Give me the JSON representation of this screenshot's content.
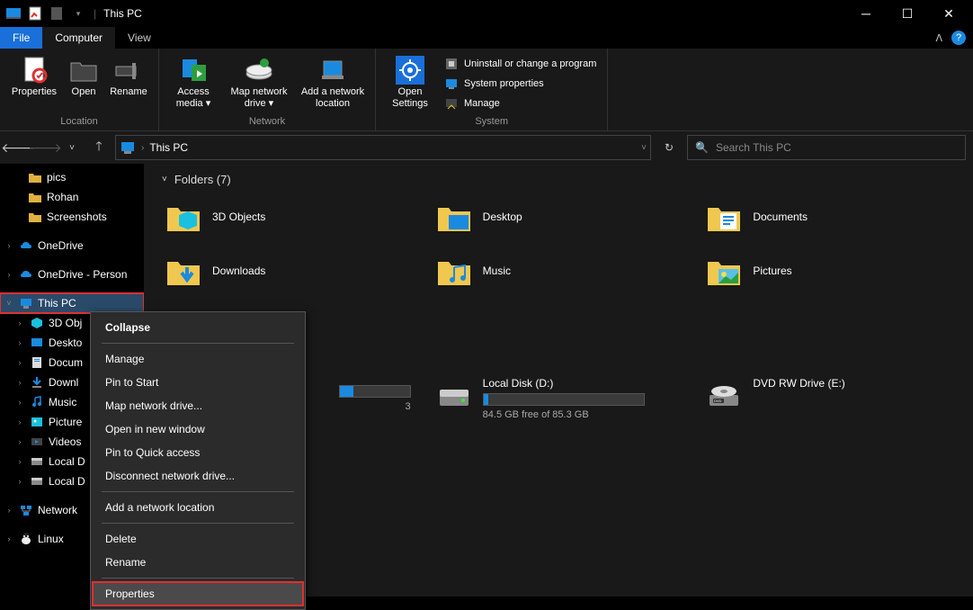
{
  "title": "This PC",
  "tabs": {
    "file": "File",
    "computer": "Computer",
    "view": "View"
  },
  "ribbon": {
    "location": {
      "group": "Location",
      "properties": "Properties",
      "open": "Open",
      "rename": "Rename"
    },
    "network": {
      "group": "Network",
      "access_media": "Access media",
      "map_drive": "Map network drive",
      "add_location": "Add a network location"
    },
    "settings": {
      "group": "System",
      "open_settings": "Open Settings",
      "uninstall": "Uninstall or change a program",
      "sysprops": "System properties",
      "manage": "Manage"
    }
  },
  "address": {
    "path": "This PC"
  },
  "search": {
    "placeholder": "Search This PC"
  },
  "sidebar": {
    "pics": "pics",
    "rohan": "Rohan",
    "screenshots": "Screenshots",
    "onedrive": "OneDrive",
    "onedrive_p": "OneDrive - Person",
    "thispc": "This PC",
    "obj3d": "3D Obj",
    "desktop": "Deskto",
    "docs": "Docum",
    "downloads": "Downl",
    "music": "Music",
    "pictures": "Picture",
    "videos": "Videos",
    "localc": "Local D",
    "locald": "Local D",
    "network": "Network",
    "linux": "Linux"
  },
  "folders": {
    "header": "Folders (7)",
    "items": [
      {
        "label": "3D Objects"
      },
      {
        "label": "Desktop"
      },
      {
        "label": "Documents"
      },
      {
        "label": "Downloads"
      },
      {
        "label": "Music"
      },
      {
        "label": "Pictures"
      }
    ]
  },
  "drives": {
    "d": {
      "label": "Local Disk (D:)",
      "sub": "84.5 GB free of 85.3 GB",
      "pct": 3
    },
    "e": {
      "label": "DVD RW Drive (E:)"
    },
    "c_partial_sub": "3"
  },
  "ctx": {
    "collapse": "Collapse",
    "manage": "Manage",
    "pin_start": "Pin to Start",
    "map_drive": "Map network drive...",
    "open_new": "Open in new window",
    "pin_qa": "Pin to Quick access",
    "disconnect": "Disconnect network drive...",
    "add_loc": "Add a network location",
    "delete": "Delete",
    "rename": "Rename",
    "properties": "Properties"
  }
}
